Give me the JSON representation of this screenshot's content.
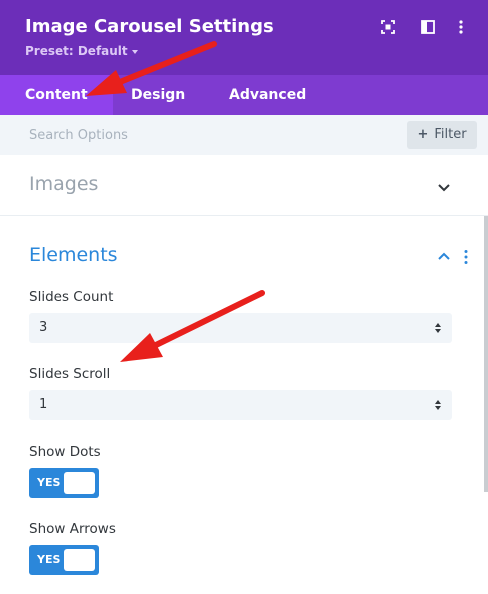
{
  "header": {
    "title": "Image Carousel Settings",
    "preset_label": "Preset: Default",
    "icons": [
      "focus-mode-icon",
      "sidebar-layout-icon",
      "more-options-icon"
    ]
  },
  "tabs": [
    {
      "label": "Content",
      "active": true
    },
    {
      "label": "Design",
      "active": false
    },
    {
      "label": "Advanced",
      "active": false
    }
  ],
  "search": {
    "placeholder": "Search Options",
    "filter_label": "Filter"
  },
  "sections": {
    "images": {
      "title": "Images",
      "expanded": false
    },
    "elements": {
      "title": "Elements",
      "expanded": true
    }
  },
  "fields": {
    "slides_count": {
      "label": "Slides Count",
      "value": "3"
    },
    "slides_scroll": {
      "label": "Slides Scroll",
      "value": "1"
    },
    "show_dots": {
      "label": "Show Dots",
      "toggle_text": "YES",
      "on": true
    },
    "show_arrows": {
      "label": "Show Arrows",
      "toggle_text": "YES",
      "on": true
    }
  },
  "colors": {
    "header_bg": "#6c2eb9",
    "tabs_bg": "#7e3bd0",
    "active_tab_bg": "#8f42ec",
    "accent_blue": "#2b87da",
    "annotation_red": "#e8201c"
  }
}
